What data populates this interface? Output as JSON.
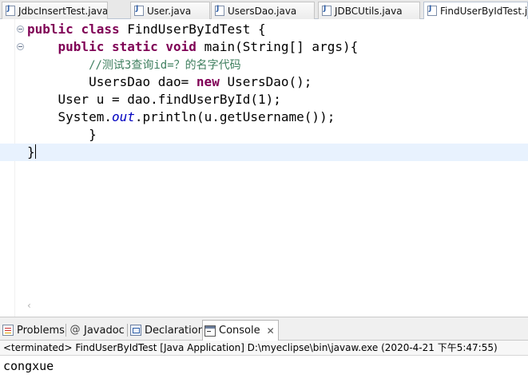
{
  "editor_tabs": [
    {
      "label": "JdbcInsertTest.java",
      "active": false
    },
    {
      "label": "User.java",
      "active": false
    },
    {
      "label": "UsersDao.java",
      "active": false
    },
    {
      "label": "JDBCUtils.java",
      "active": false
    },
    {
      "label": "FindUserByIdTest.java",
      "active": true
    }
  ],
  "code": {
    "l1_kw1": "public",
    "l1_kw2": "class",
    "l1_rest": " FindUserByIdTest {",
    "l2_kw1": "public",
    "l2_kw2": "static",
    "l2_kw3": "void",
    "l2_rest": " main(String[] args){",
    "l3_comment": "//测试3查询id=？的名字代码",
    "l4_pre": "UsersDao dao= ",
    "l4_kw": "new",
    "l4_post": " UsersDao();",
    "l5_text": "User u = dao.findUserById(1);",
    "l6_pre": "System.",
    "l6_static": "out",
    "l6_post": ".println(u.getUsername());",
    "l7_text": "}",
    "l8_text": "}"
  },
  "views": {
    "problems": "Problems",
    "javadoc": "Javadoc",
    "declaration": "Declaration",
    "console": "Console",
    "close_glyph": "✕"
  },
  "console": {
    "header": "<terminated> FindUserByIdTest [Java Application] D:\\myeclipse\\bin\\javaw.exe (2020-4-21 下午5:47:55)",
    "output": "congxue"
  },
  "scroll_arrow": "‹"
}
